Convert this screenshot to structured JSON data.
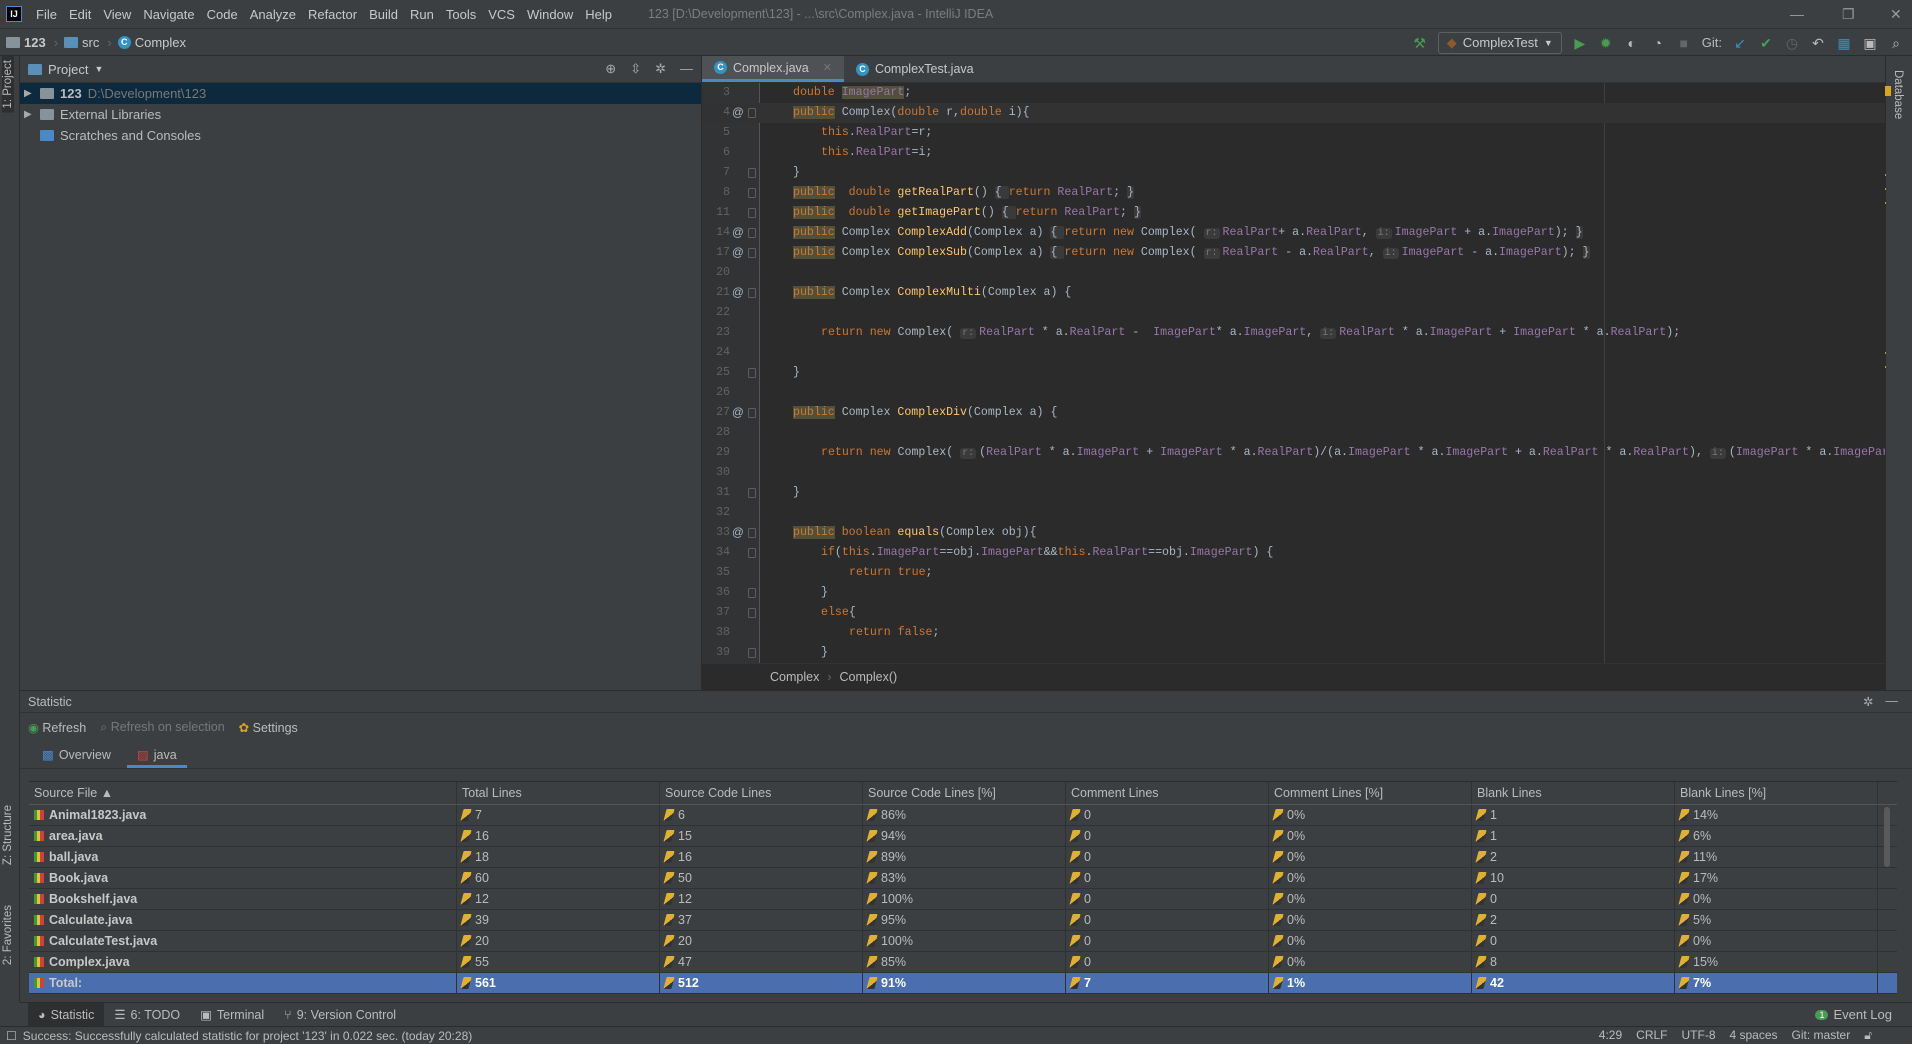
{
  "window": {
    "title": "123 [D:\\Development\\123] - ...\\src\\Complex.java - IntelliJ IDEA",
    "logo": "IJ"
  },
  "menu": [
    "File",
    "Edit",
    "View",
    "Navigate",
    "Code",
    "Analyze",
    "Refactor",
    "Build",
    "Run",
    "Tools",
    "VCS",
    "Window",
    "Help"
  ],
  "breadcrumb": [
    "123",
    "src",
    "Complex"
  ],
  "toolbar": {
    "run_config": "ComplexTest",
    "git_label": "Git:"
  },
  "left_stripe": {
    "project": "1: Project",
    "structure": "Z: Structure",
    "favorites": "2: Favorites"
  },
  "right_stripe": {
    "database": "Database"
  },
  "project": {
    "title": "Project",
    "items": [
      {
        "label": "123",
        "path": "D:\\Development\\123",
        "selected": true,
        "expandable": true
      },
      {
        "label": "External Libraries",
        "path": "",
        "selected": false,
        "expandable": true
      },
      {
        "label": "Scratches and Consoles",
        "path": "",
        "selected": false,
        "expandable": false
      }
    ]
  },
  "editor": {
    "tabs": [
      {
        "label": "Complex.java",
        "active": true
      },
      {
        "label": "ComplexTest.java",
        "active": false
      }
    ],
    "lines": [
      {
        "n": "3",
        "at": false,
        "fold": false,
        "ind": 0,
        "tk": [
          [
            "k",
            "double "
          ],
          [
            "fs",
            "ImagePart"
          ],
          [
            "t",
            ";"
          ]
        ]
      },
      {
        "n": "4",
        "at": true,
        "fold": true,
        "ind": 0,
        "caret": true,
        "tk": [
          [
            "kh",
            "public"
          ],
          [
            "t",
            " Complex("
          ],
          [
            "k",
            "double "
          ],
          [
            "t",
            "r,"
          ],
          [
            "k",
            "double "
          ],
          [
            "t",
            "i){"
          ]
        ]
      },
      {
        "n": "5",
        "at": false,
        "fold": false,
        "ind": 1,
        "tk": [
          [
            "k",
            "this"
          ],
          [
            "t",
            "."
          ],
          [
            "f",
            "RealPart"
          ],
          [
            "t",
            "=r;"
          ]
        ]
      },
      {
        "n": "6",
        "at": false,
        "fold": false,
        "ind": 1,
        "tk": [
          [
            "k",
            "this"
          ],
          [
            "t",
            "."
          ],
          [
            "f",
            "RealPart"
          ],
          [
            "t",
            "=i;"
          ]
        ]
      },
      {
        "n": "7",
        "at": false,
        "fold": true,
        "ind": 0,
        "tk": [
          [
            "t",
            "}"
          ]
        ]
      },
      {
        "n": "8",
        "at": false,
        "fold": true,
        "ind": 0,
        "tk": [
          [
            "kh",
            "public"
          ],
          [
            "t",
            "  "
          ],
          [
            "k",
            "double "
          ],
          [
            "m",
            "getRealPart"
          ],
          [
            "t",
            "() "
          ],
          [
            "fb",
            "{ "
          ],
          [
            "k",
            "return "
          ],
          [
            "f",
            "RealPart"
          ],
          [
            "t",
            "; "
          ],
          [
            "fb",
            "}"
          ]
        ]
      },
      {
        "n": "11",
        "at": false,
        "fold": true,
        "ind": 0,
        "tk": [
          [
            "kh",
            "public"
          ],
          [
            "t",
            "  "
          ],
          [
            "k",
            "double "
          ],
          [
            "m",
            "getImagePart"
          ],
          [
            "t",
            "() "
          ],
          [
            "fb",
            "{ "
          ],
          [
            "k",
            "return "
          ],
          [
            "f",
            "RealPart"
          ],
          [
            "t",
            "; "
          ],
          [
            "fb",
            "}"
          ]
        ]
      },
      {
        "n": "14",
        "at": true,
        "fold": true,
        "ind": 0,
        "tk": [
          [
            "kh",
            "public"
          ],
          [
            "t",
            " Complex "
          ],
          [
            "m",
            "ComplexAdd"
          ],
          [
            "t",
            "(Complex a) "
          ],
          [
            "fb",
            "{ "
          ],
          [
            "k",
            "return new "
          ],
          [
            "t",
            "Complex( "
          ],
          [
            "h",
            "r:"
          ],
          [
            "f",
            "RealPart"
          ],
          [
            "t",
            "+ a."
          ],
          [
            "f",
            "RealPart"
          ],
          [
            "t",
            ", "
          ],
          [
            "h",
            "i:"
          ],
          [
            "f",
            "ImagePart"
          ],
          [
            "t",
            " + a."
          ],
          [
            "f",
            "ImagePart"
          ],
          [
            "t",
            "); "
          ],
          [
            "fb",
            "}"
          ]
        ]
      },
      {
        "n": "17",
        "at": true,
        "fold": true,
        "ind": 0,
        "tk": [
          [
            "kh",
            "public"
          ],
          [
            "t",
            " Complex "
          ],
          [
            "m",
            "ComplexSub"
          ],
          [
            "t",
            "(Complex a) "
          ],
          [
            "fb",
            "{ "
          ],
          [
            "k",
            "return new "
          ],
          [
            "t",
            "Complex( "
          ],
          [
            "h",
            "r:"
          ],
          [
            "f",
            "RealPart"
          ],
          [
            "t",
            " - a."
          ],
          [
            "f",
            "RealPart"
          ],
          [
            "t",
            ", "
          ],
          [
            "h",
            "i:"
          ],
          [
            "f",
            "ImagePart"
          ],
          [
            "t",
            " - a."
          ],
          [
            "f",
            "ImagePart"
          ],
          [
            "t",
            "); "
          ],
          [
            "fb",
            "}"
          ]
        ]
      },
      {
        "n": "20",
        "at": false,
        "fold": false,
        "ind": 0,
        "tk": []
      },
      {
        "n": "21",
        "at": true,
        "fold": true,
        "ind": 0,
        "tk": [
          [
            "kh",
            "public"
          ],
          [
            "t",
            " Complex "
          ],
          [
            "m",
            "ComplexMulti"
          ],
          [
            "t",
            "(Complex a) {"
          ]
        ]
      },
      {
        "n": "22",
        "at": false,
        "fold": false,
        "ind": 0,
        "tk": []
      },
      {
        "n": "23",
        "at": false,
        "fold": false,
        "ind": 1,
        "tk": [
          [
            "k",
            "return new "
          ],
          [
            "t",
            "Complex( "
          ],
          [
            "h",
            "r:"
          ],
          [
            "f",
            "RealPart"
          ],
          [
            "t",
            " * a."
          ],
          [
            "f",
            "RealPart"
          ],
          [
            "t",
            " -  "
          ],
          [
            "f",
            "ImagePart"
          ],
          [
            "t",
            "* a."
          ],
          [
            "f",
            "ImagePart"
          ],
          [
            "t",
            ", "
          ],
          [
            "h",
            "i:"
          ],
          [
            "f",
            "RealPart"
          ],
          [
            "t",
            " * a."
          ],
          [
            "f",
            "ImagePart"
          ],
          [
            "t",
            " + "
          ],
          [
            "f",
            "ImagePart"
          ],
          [
            "t",
            " * a."
          ],
          [
            "f",
            "RealPart"
          ],
          [
            "t",
            ");"
          ]
        ]
      },
      {
        "n": "24",
        "at": false,
        "fold": false,
        "ind": 0,
        "tk": []
      },
      {
        "n": "25",
        "at": false,
        "fold": true,
        "ind": 0,
        "tk": [
          [
            "t",
            "}"
          ]
        ]
      },
      {
        "n": "26",
        "at": false,
        "fold": false,
        "ind": 0,
        "tk": []
      },
      {
        "n": "27",
        "at": true,
        "fold": true,
        "ind": 0,
        "tk": [
          [
            "kh",
            "public"
          ],
          [
            "t",
            " Complex "
          ],
          [
            "m",
            "ComplexDiv"
          ],
          [
            "t",
            "(Complex a) {"
          ]
        ]
      },
      {
        "n": "28",
        "at": false,
        "fold": false,
        "ind": 0,
        "tk": []
      },
      {
        "n": "29",
        "at": false,
        "fold": false,
        "ind": 1,
        "tk": [
          [
            "k",
            "return new "
          ],
          [
            "t",
            "Complex( "
          ],
          [
            "h",
            "r:"
          ],
          [
            "t",
            "("
          ],
          [
            "f",
            "RealPart"
          ],
          [
            "t",
            " * a."
          ],
          [
            "f",
            "ImagePart"
          ],
          [
            "t",
            " + "
          ],
          [
            "f",
            "ImagePart"
          ],
          [
            "t",
            " * a."
          ],
          [
            "f",
            "RealPart"
          ],
          [
            "t",
            ")/(a."
          ],
          [
            "f",
            "ImagePart"
          ],
          [
            "t",
            " * a."
          ],
          [
            "f",
            "ImagePart"
          ],
          [
            "t",
            " + a."
          ],
          [
            "f",
            "RealPart"
          ],
          [
            "t",
            " * a."
          ],
          [
            "f",
            "RealPart"
          ],
          [
            "t",
            "), "
          ],
          [
            "h",
            "i:"
          ],
          [
            "t",
            "("
          ],
          [
            "f",
            "ImagePart"
          ],
          [
            "t",
            " * a."
          ],
          [
            "f",
            "ImagePart"
          ]
        ]
      },
      {
        "n": "30",
        "at": false,
        "fold": false,
        "ind": 0,
        "tk": []
      },
      {
        "n": "31",
        "at": false,
        "fold": true,
        "ind": 0,
        "tk": [
          [
            "t",
            "}"
          ]
        ]
      },
      {
        "n": "32",
        "at": false,
        "fold": false,
        "ind": 0,
        "tk": []
      },
      {
        "n": "33",
        "at": true,
        "fold": true,
        "ind": 0,
        "tk": [
          [
            "kh",
            "public"
          ],
          [
            "k",
            " boolean "
          ],
          [
            "m",
            "equals"
          ],
          [
            "t",
            "(Complex obj){"
          ]
        ]
      },
      {
        "n": "34",
        "at": false,
        "fold": true,
        "ind": 1,
        "tk": [
          [
            "k",
            "if"
          ],
          [
            "t",
            "("
          ],
          [
            "k",
            "this"
          ],
          [
            "t",
            "."
          ],
          [
            "f",
            "ImagePart"
          ],
          [
            "t",
            "==obj."
          ],
          [
            "f",
            "ImagePart"
          ],
          [
            "t",
            "&&"
          ],
          [
            "k",
            "this"
          ],
          [
            "t",
            "."
          ],
          [
            "f",
            "RealPart"
          ],
          [
            "t",
            "==obj."
          ],
          [
            "f",
            "ImagePart"
          ],
          [
            "t",
            ") {"
          ]
        ]
      },
      {
        "n": "35",
        "at": false,
        "fold": false,
        "ind": 2,
        "tk": [
          [
            "k",
            "return true"
          ],
          [
            "t",
            ";"
          ]
        ]
      },
      {
        "n": "36",
        "at": false,
        "fold": true,
        "ind": 1,
        "tk": [
          [
            "t",
            "}"
          ]
        ]
      },
      {
        "n": "37",
        "at": false,
        "fold": true,
        "ind": 1,
        "tk": [
          [
            "k",
            "else"
          ],
          [
            "t",
            "{"
          ]
        ]
      },
      {
        "n": "38",
        "at": false,
        "fold": false,
        "ind": 2,
        "tk": [
          [
            "k",
            "return false"
          ],
          [
            "t",
            ";"
          ]
        ]
      },
      {
        "n": "39",
        "at": false,
        "fold": true,
        "ind": 1,
        "tk": [
          [
            "t",
            "}"
          ]
        ]
      }
    ],
    "breadcrumb": [
      "Complex",
      "Complex()"
    ]
  },
  "statistic": {
    "title": "Statistic",
    "toolbar": {
      "refresh": "Refresh",
      "refresh_selection": "Refresh on selection",
      "settings": "Settings"
    },
    "tabs": [
      {
        "label": "Overview",
        "active": false
      },
      {
        "label": "java",
        "active": true
      }
    ],
    "columns": [
      "Source File ▲",
      "Total Lines",
      "Source Code Lines",
      "Source Code Lines [%]",
      "Comment Lines",
      "Comment Lines [%]",
      "Blank Lines",
      "Blank Lines [%]"
    ],
    "rows": [
      [
        "Animal1823.java",
        "7",
        "6",
        "86%",
        "0",
        "0%",
        "1",
        "14%"
      ],
      [
        "area.java",
        "16",
        "15",
        "94%",
        "0",
        "0%",
        "1",
        "6%"
      ],
      [
        "ball.java",
        "18",
        "16",
        "89%",
        "0",
        "0%",
        "2",
        "11%"
      ],
      [
        "Book.java",
        "60",
        "50",
        "83%",
        "0",
        "0%",
        "10",
        "17%"
      ],
      [
        "Bookshelf.java",
        "12",
        "12",
        "100%",
        "0",
        "0%",
        "0",
        "0%"
      ],
      [
        "Calculate.java",
        "39",
        "37",
        "95%",
        "0",
        "0%",
        "2",
        "5%"
      ],
      [
        "CalculateTest.java",
        "20",
        "20",
        "100%",
        "0",
        "0%",
        "0",
        "0%"
      ],
      [
        "Complex.java",
        "55",
        "47",
        "85%",
        "0",
        "0%",
        "8",
        "15%"
      ]
    ],
    "total": [
      "Total:",
      "561",
      "512",
      "91%",
      "7",
      "1%",
      "42",
      "7%"
    ]
  },
  "bottom_tabs": [
    "Statistic",
    "6: TODO",
    "Terminal",
    "9: Version Control"
  ],
  "event_log": {
    "label": "Event Log",
    "count": "1"
  },
  "status": {
    "message": "Success: Successfully calculated statistic for project '123' in 0.022 sec. (today 20:28)",
    "position": "4:29",
    "line_sep": "CRLF",
    "encoding": "UTF-8",
    "indent": "4 spaces",
    "git": "Git: master"
  }
}
